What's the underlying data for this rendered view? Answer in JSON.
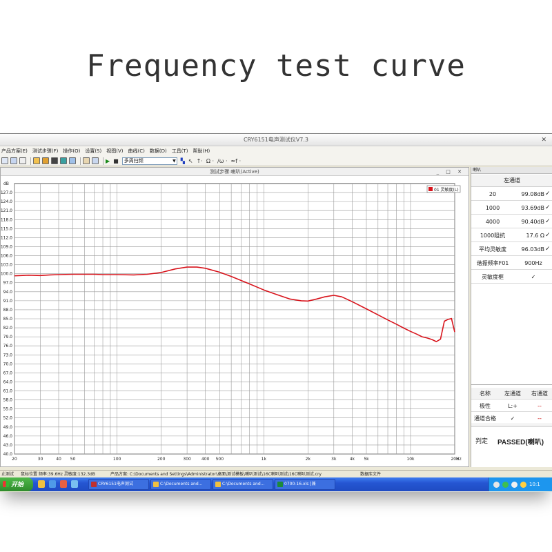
{
  "headline": "Frequency test curve",
  "window": {
    "title": "CRY6151电声测试仪V7.3",
    "close_glyph": "✕",
    "menu": [
      "产品方案(E)",
      "测试步骤(F)",
      "操作(O)",
      "设置(S)",
      "视图(V)",
      "曲线(C)",
      "数据(D)",
      "工具(T)",
      "帮助(H)"
    ],
    "toolbar_mode": "多周扫频",
    "toolbar_glyphs": [
      "↖",
      "↑·",
      "Ω ·",
      "/ω ·",
      "≈f ·"
    ]
  },
  "plot_window": {
    "caption": "测试步骤:喇叭(Active)",
    "controls": "_ □ ✕"
  },
  "right_panel": {
    "tab": "喇叭",
    "channel_header": "左通道",
    "rows": [
      {
        "label": "20",
        "value": "99.08dB",
        "check": "✓"
      },
      {
        "label": "1000",
        "value": "93.69dB",
        "check": "✓"
      },
      {
        "label": "4000",
        "value": "90.40dB",
        "check": "✓"
      },
      {
        "label": "1000阻抗",
        "value": "17.6 Ω",
        "check": "✓"
      },
      {
        "label": "平均灵敏度",
        "value": "96.03dB",
        "check": "✓"
      }
    ],
    "resonance": {
      "label": "谐振频率F01",
      "value": "900Hz"
    },
    "sensitivity_curve": {
      "label": "灵敏度框",
      "value": "✓"
    },
    "table2": {
      "headers": [
        "名称",
        "左通道",
        "右通道"
      ],
      "rows": [
        {
          "name": "极性",
          "left": "L:+",
          "right": "--"
        },
        {
          "name": "通道合格",
          "left": "✓",
          "right": "--"
        }
      ]
    },
    "verdict": {
      "label": "判定",
      "value": "PASSED(喇叭)"
    }
  },
  "status_bar": {
    "left": "止测试",
    "cursor": "鼠标位置 频率:39.6Hz 灵敏度:132.3dB",
    "scheme": "产品方案: C:\\Documents and Settings\\Administrator\\桌面\\测试模板\\喇叭测试\\16C喇叭测试\\16C喇叭测试.cry",
    "database": "数据库文件"
  },
  "taskbar": {
    "start_label": "开始",
    "tasks": [
      "CRY6151电声测试",
      "C:\\Documents and...",
      "C:\\Documents and...",
      "0700-16.xls [兼"
    ],
    "clock": "10:1"
  },
  "colors": {
    "curve": "#d8141c",
    "grid": "#9a9a9a",
    "taskbar": "#2556d2",
    "start": "#2e8b2b"
  },
  "chart_data": {
    "type": "line",
    "title": "",
    "xlabel": "Hz",
    "ylabel": "dB",
    "x_scale": "log",
    "xlim": [
      20,
      20000
    ],
    "ylim": [
      40,
      130
    ],
    "grid": true,
    "legend_position": "top-right",
    "y_ticks": [
      40.0,
      43.0,
      46.0,
      49.0,
      52.0,
      55.0,
      58.0,
      61.0,
      64.0,
      67.0,
      70.0,
      73.0,
      76.0,
      79.0,
      82.0,
      85.0,
      88.0,
      91.0,
      94.0,
      97.0,
      100.0,
      103.0,
      106.0,
      109.0,
      112.0,
      115.0,
      118.0,
      121.0,
      124.0,
      127.0
    ],
    "x_tick_labels": [
      {
        "v": 20,
        "t": "20"
      },
      {
        "v": 30,
        "t": "30"
      },
      {
        "v": 40,
        "t": "40"
      },
      {
        "v": 50,
        "t": "50"
      },
      {
        "v": 100,
        "t": "100"
      },
      {
        "v": 200,
        "t": "200"
      },
      {
        "v": 300,
        "t": "300"
      },
      {
        "v": 400,
        "t": "400"
      },
      {
        "v": 500,
        "t": "500"
      },
      {
        "v": 1000,
        "t": "1k"
      },
      {
        "v": 2000,
        "t": "2k"
      },
      {
        "v": 3000,
        "t": "3k"
      },
      {
        "v": 4000,
        "t": "4k"
      },
      {
        "v": 5000,
        "t": "5k"
      },
      {
        "v": 10000,
        "t": "10k"
      },
      {
        "v": 20000,
        "t": "20k"
      }
    ],
    "series": [
      {
        "name": "01 灵敏度(L)",
        "x": [
          20,
          25,
          30,
          35,
          40,
          50,
          60,
          70,
          80,
          100,
          130,
          160,
          200,
          250,
          300,
          350,
          400,
          500,
          600,
          800,
          1000,
          1200,
          1500,
          1800,
          2000,
          2300,
          2600,
          3000,
          3400,
          4000,
          5000,
          6000,
          7000,
          8000,
          9000,
          10000,
          11000,
          12000,
          13000,
          14000,
          15000,
          16000,
          17000,
          18000,
          19000,
          20000
        ],
        "y": [
          99.3,
          99.5,
          99.4,
          99.6,
          99.7,
          99.8,
          99.8,
          99.8,
          99.7,
          99.7,
          99.6,
          99.8,
          100.4,
          101.6,
          102.2,
          102.2,
          101.8,
          100.5,
          99.1,
          96.6,
          94.6,
          93.2,
          91.6,
          91.0,
          90.9,
          91.6,
          92.3,
          92.8,
          92.3,
          90.7,
          88.3,
          86.3,
          84.6,
          83.2,
          81.9,
          80.8,
          79.9,
          79.0,
          78.6,
          78.1,
          77.4,
          78.2,
          84.2,
          84.8,
          85.1,
          80.6
        ]
      }
    ]
  }
}
